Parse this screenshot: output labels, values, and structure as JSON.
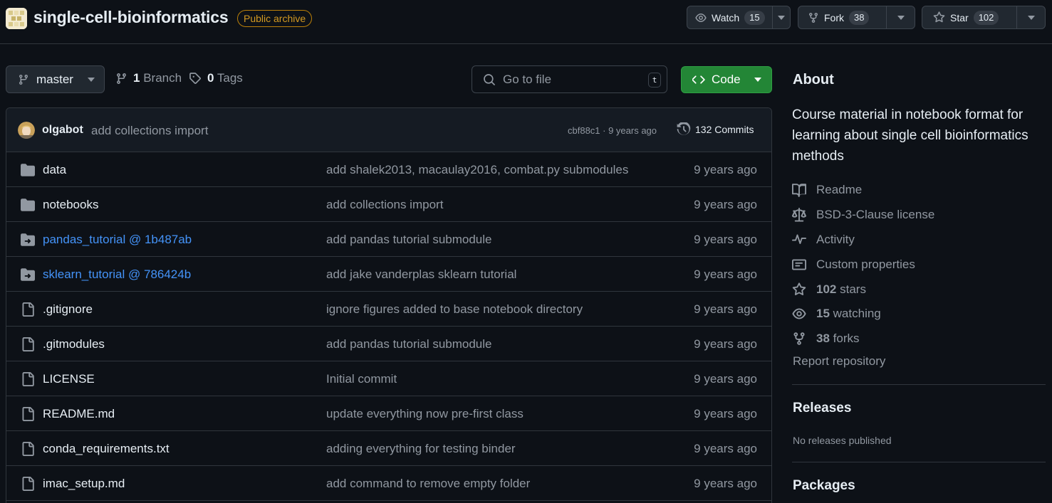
{
  "repo": {
    "name": "single-cell-bioinformatics",
    "badge": "Public archive"
  },
  "header_buttons": {
    "watch": {
      "label": "Watch",
      "count": "15"
    },
    "fork": {
      "label": "Fork",
      "count": "38"
    },
    "star": {
      "label": "Star",
      "count": "102"
    }
  },
  "toolbar": {
    "branch": "master",
    "branches_count": "1",
    "branches_label": "Branch",
    "tags_count": "0",
    "tags_label": "Tags",
    "goto_placeholder": "Go to file",
    "goto_shortcut": "t",
    "code_label": "Code"
  },
  "latest_commit": {
    "author": "olgabot",
    "message": "add collections import",
    "hash_age": "cbf88c1 · 9 years ago",
    "commits_label": "132 Commits"
  },
  "files": [
    {
      "type": "folder",
      "name": "data",
      "message": "add shalek2013, macaulay2016, combat.py submodules",
      "age": "9 years ago"
    },
    {
      "type": "folder",
      "name": "notebooks",
      "message": "add collections import",
      "age": "9 years ago"
    },
    {
      "type": "submodule",
      "name": "pandas_tutorial @ 1b487ab",
      "message": "add pandas tutorial submodule",
      "age": "9 years ago"
    },
    {
      "type": "submodule",
      "name": "sklearn_tutorial @ 786424b",
      "message": "add jake vanderplas sklearn tutorial",
      "age": "9 years ago"
    },
    {
      "type": "file",
      "name": ".gitignore",
      "message": "ignore figures added to base notebook directory",
      "age": "9 years ago"
    },
    {
      "type": "file",
      "name": ".gitmodules",
      "message": "add pandas tutorial submodule",
      "age": "9 years ago"
    },
    {
      "type": "file",
      "name": "LICENSE",
      "message": "Initial commit",
      "age": "9 years ago"
    },
    {
      "type": "file",
      "name": "README.md",
      "message": "update everything now pre-first class",
      "age": "9 years ago"
    },
    {
      "type": "file",
      "name": "conda_requirements.txt",
      "message": "adding everything for testing binder",
      "age": "9 years ago"
    },
    {
      "type": "file",
      "name": "imac_setup.md",
      "message": "add command to remove empty folder",
      "age": "9 years ago"
    }
  ],
  "about": {
    "title": "About",
    "description": "Course material in notebook format for learning about single cell bioinformatics methods",
    "readme": "Readme",
    "license": "BSD-3-Clause license",
    "activity": "Activity",
    "custom_properties": "Custom properties",
    "stars_count": "102",
    "stars_label": "stars",
    "watching_count": "15",
    "watching_label": "watching",
    "forks_count": "38",
    "forks_label": "forks",
    "report": "Report repository"
  },
  "releases": {
    "title": "Releases",
    "none": "No releases published"
  },
  "packages": {
    "title": "Packages"
  },
  "colors": {
    "background": "#0d1117",
    "border": "#30363d",
    "accent_green": "#238636",
    "link_blue": "#4493f8",
    "archive_badge": "#d29922"
  }
}
